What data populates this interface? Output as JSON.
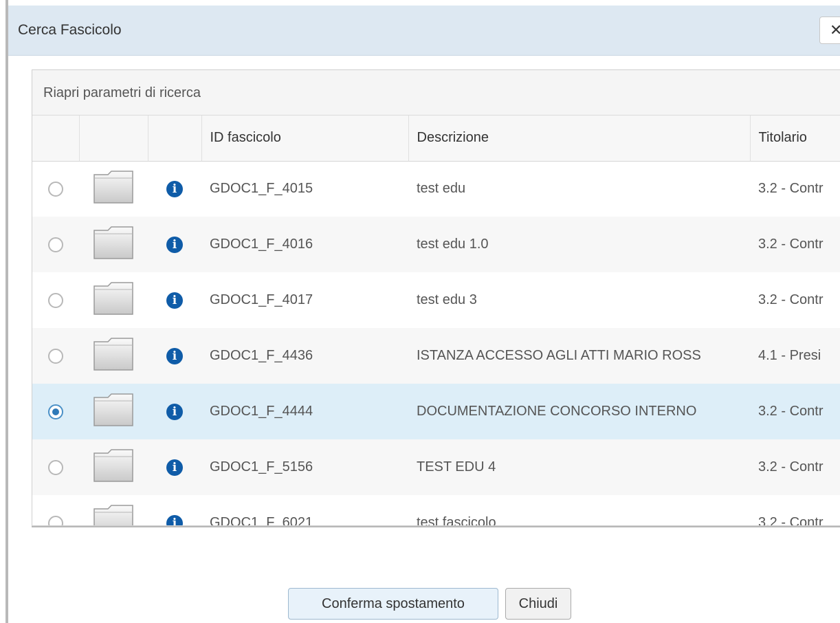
{
  "dialog": {
    "title": "Cerca Fascicolo",
    "close_icon": "close-icon"
  },
  "panel": {
    "header_label": "Riapri parametri di ricerca"
  },
  "table": {
    "columns": [
      "",
      "",
      "",
      "ID fascicolo",
      "Descrizione",
      "Titolario"
    ],
    "rows": [
      {
        "id": "GDOC1_F_4015",
        "descrizione": "test edu",
        "titolario": "3.2 - Contr",
        "selected": false
      },
      {
        "id": "GDOC1_F_4016",
        "descrizione": "test edu 1.0",
        "titolario": "3.2 - Contr",
        "selected": false
      },
      {
        "id": "GDOC1_F_4017",
        "descrizione": "test edu 3",
        "titolario": "3.2 - Contr",
        "selected": false
      },
      {
        "id": "GDOC1_F_4436",
        "descrizione": "ISTANZA ACCESSO AGLI ATTI MARIO ROSS",
        "titolario": "4.1 - Presi",
        "selected": false
      },
      {
        "id": "GDOC1_F_4444",
        "descrizione": "DOCUMENTAZIONE CONCORSO INTERNO",
        "titolario": "3.2 - Contr",
        "selected": true
      },
      {
        "id": "GDOC1_F_5156",
        "descrizione": "TEST EDU 4",
        "titolario": "3.2 - Contr",
        "selected": false
      },
      {
        "id": "GDOC1_F_6021",
        "descrizione": "test fascicolo",
        "titolario": "3.2 - Contr",
        "selected": false
      }
    ]
  },
  "buttons": {
    "confirm": "Conferma spostamento",
    "close": "Chiudi"
  },
  "colors": {
    "titlebar": "#dde8f2",
    "selected_row": "#ddeef8",
    "info_icon": "#0f5ca8"
  }
}
